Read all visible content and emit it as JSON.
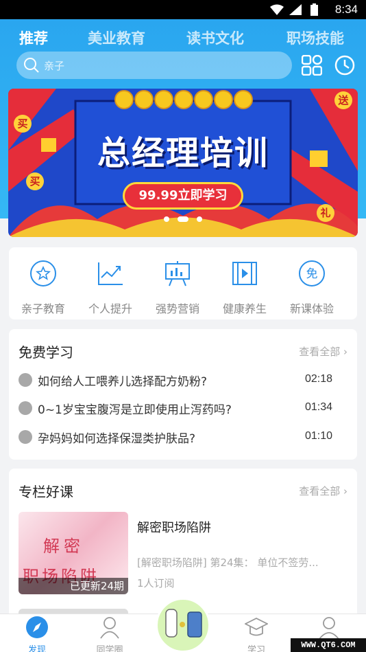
{
  "status_bar": {
    "time": "8:34"
  },
  "top_tabs": [
    "推荐",
    "美业教育",
    "读书文化",
    "职场技能"
  ],
  "search": {
    "placeholder": "亲子"
  },
  "banner": {
    "title": "总经理培训",
    "cta": "99.99立即学习",
    "badges": [
      "买",
      "买",
      "送",
      "礼"
    ]
  },
  "categories": [
    {
      "label": "亲子教育",
      "icon": "star-circle-icon"
    },
    {
      "label": "个人提升",
      "icon": "growth-chart-icon"
    },
    {
      "label": "强势营销",
      "icon": "presentation-board-icon"
    },
    {
      "label": "健康养生",
      "icon": "video-play-icon"
    },
    {
      "label": "新课体验",
      "icon": "free-badge-icon"
    }
  ],
  "free_study": {
    "title": "免费学习",
    "see_all": "查看全部",
    "items": [
      {
        "text": "如何给人工喂养儿选择配方奶粉?",
        "duration": "02:18"
      },
      {
        "text": "0~1岁宝宝腹泻是立即使用止泻药吗?",
        "duration": "01:34"
      },
      {
        "text": "孕妈妈如何选择保湿类护肤品?",
        "duration": "01:10"
      }
    ]
  },
  "column": {
    "title": "专栏好课",
    "see_all": "查看全部",
    "course": {
      "thumb_line1": "解密",
      "thumb_line2": "职场陷阱",
      "updated": "已更新24期",
      "title": "解密职场陷阱",
      "desc": "[解密职场陷阱] 第24集： 单位不签劳...",
      "subs": "1人订阅"
    }
  },
  "bottom_nav": [
    {
      "label": "发现",
      "icon": "compass-icon",
      "active": true
    },
    {
      "label": "同学圈",
      "icon": "people-icon"
    },
    {
      "label": "学习",
      "icon": "graduation-cap-icon"
    },
    {
      "label": "",
      "icon": "profile-icon"
    }
  ],
  "watermark": "WWW.QT6.COM",
  "colors": {
    "header": "#2aa6ef",
    "accent": "#2a8fe8",
    "banner_bg": "#1f48c9",
    "banner_cta": "#e8303a"
  }
}
